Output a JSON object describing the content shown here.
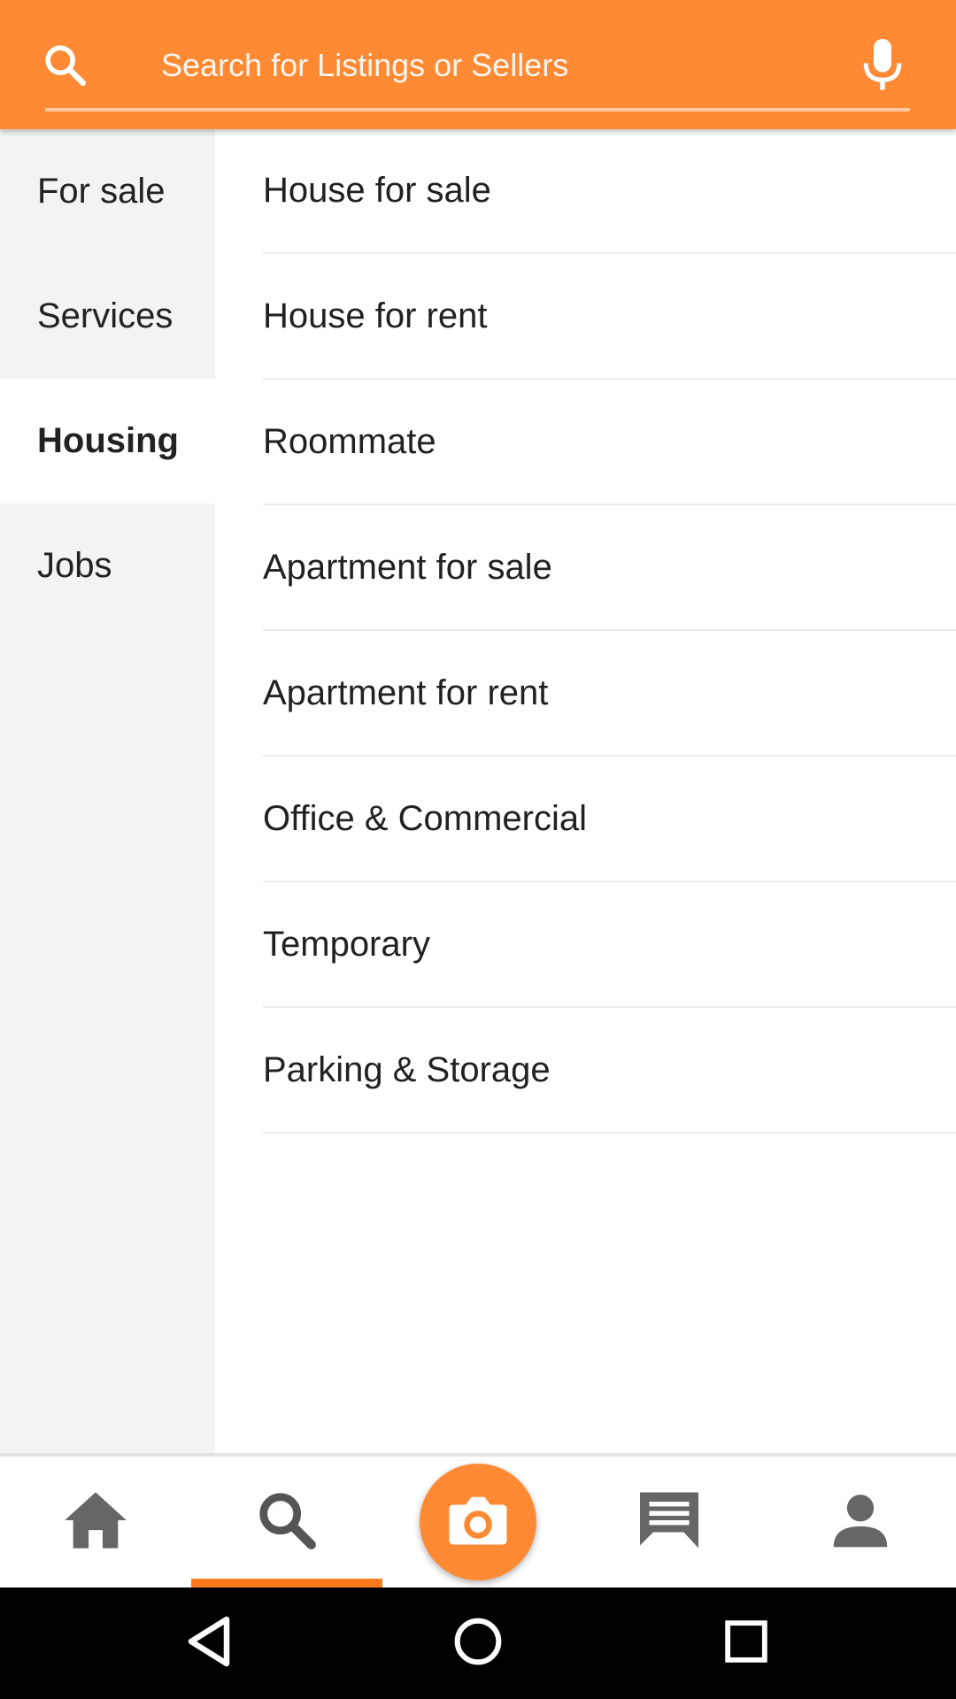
{
  "search": {
    "placeholder": "Search for Listings or Sellers",
    "value": ""
  },
  "sidebar": {
    "items": [
      {
        "label": "For sale",
        "active": false
      },
      {
        "label": "Services",
        "active": false
      },
      {
        "label": "Housing",
        "active": true
      },
      {
        "label": "Jobs",
        "active": false
      }
    ]
  },
  "subcategories": [
    {
      "label": "House for sale"
    },
    {
      "label": "House for rent"
    },
    {
      "label": "Roommate"
    },
    {
      "label": "Apartment for sale"
    },
    {
      "label": "Apartment for rent"
    },
    {
      "label": "Office & Commercial"
    },
    {
      "label": "Temporary"
    },
    {
      "label": "Parking & Storage"
    }
  ],
  "bottom_nav": {
    "items": [
      {
        "icon": "home-icon"
      },
      {
        "icon": "search-icon",
        "selected": true
      },
      {
        "icon": "camera-icon"
      },
      {
        "icon": "chat-icon"
      },
      {
        "icon": "profile-icon"
      }
    ]
  },
  "system_nav": {
    "items": [
      {
        "icon": "back-icon"
      },
      {
        "icon": "home-circle-icon"
      },
      {
        "icon": "recents-icon"
      }
    ]
  },
  "colors": {
    "accent": "#ff8a33",
    "indicator": "#ff7a1a",
    "sidebar_bg": "#f3f3f3",
    "icon_gray": "#666666"
  }
}
